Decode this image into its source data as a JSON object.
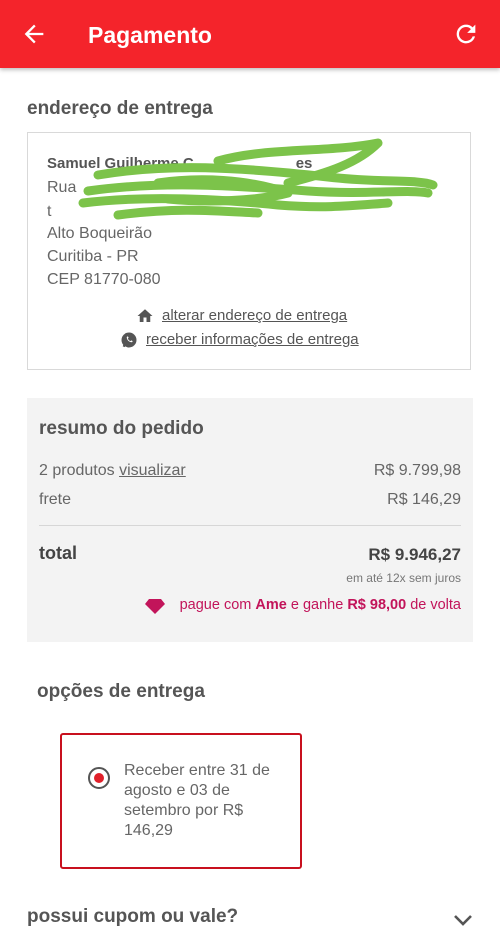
{
  "header": {
    "title": "Pagamento",
    "back_icon": "arrow-left-icon",
    "refresh_icon": "refresh-icon"
  },
  "address": {
    "section_title": "endereço de entrega",
    "name": "Samuel Guilherme C",
    "name_tail": "es",
    "line1": "Rua",
    "line2": "t",
    "line3": "Alto Boqueirão",
    "line4": "Curitiba - PR",
    "line5": "CEP 81770-080",
    "change_link": "alterar endereço de entrega",
    "info_link": "receber informações de entrega"
  },
  "summary": {
    "title": "resumo do pedido",
    "products_label": "2 produtos",
    "products_link": "visualizar",
    "products_value": "R$ 9.799,98",
    "shipping_label": "frete",
    "shipping_value": "R$ 146,29",
    "total_label": "total",
    "total_value": "R$ 9.946,27",
    "installments": "em até 12x sem juros",
    "ame_prefix": "pague com",
    "ame_brand": "Ame",
    "ame_mid": "e ganhe",
    "ame_amount": "R$ 98,00",
    "ame_suffix": "de volta",
    "ame_color": "#c2145a"
  },
  "delivery": {
    "section_title": "opções de entrega",
    "option_text": "Receber entre 31 de agosto e 03 de setembro por R$ 146,29",
    "selected": true
  },
  "coupon": {
    "title": "possui cupom ou vale?"
  },
  "colors": {
    "brand_red": "#f4242b",
    "scribble_green": "#7cc34a"
  }
}
